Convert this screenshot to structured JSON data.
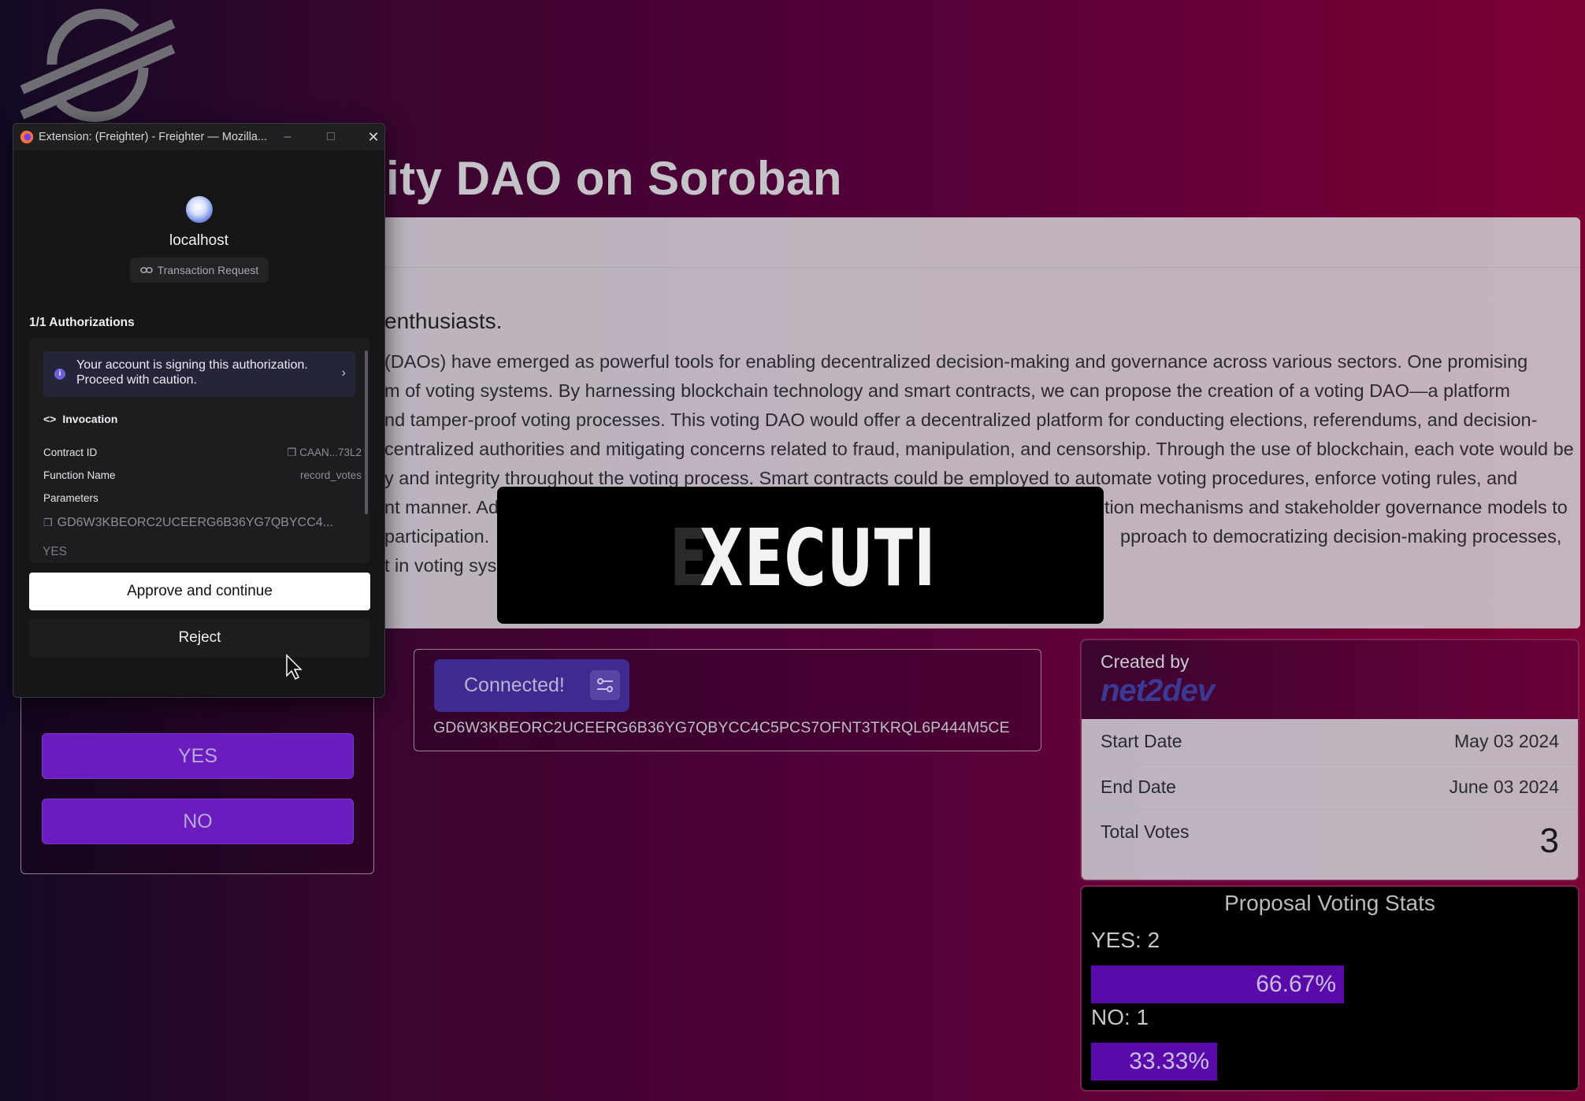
{
  "page": {
    "title": "ity DAO on Soroban"
  },
  "intro": {
    "heading": "enthusiasts.",
    "lines": [
      "(DAOs) have emerged as powerful tools for enabling decentralized decision-making and governance across various sectors. One promising",
      "m of voting systems. By harnessing blockchain technology and smart contracts, we can propose the creation of a voting DAO—a platform",
      "nd tamper-proof voting processes. This voting DAO would offer a decentralized platform for conducting elections, referendums, and decision-",
      " centralized authorities and mitigating concerns related to fraud, manipulation, and censorship. Through the use of blockchain, each vote would be",
      "y and integrity throughout the voting process. Smart contracts could be employed to automate voting procedures, enforce voting rules, and",
      "nt manner. Add",
      "participation.",
      "t in voting syst"
    ],
    "line_tails": {
      "5": "tion mechanisms and stakeholder governance models to",
      "6": "pproach to democratizing decision-making processes,"
    }
  },
  "overlay": {
    "ghost_letter": "E",
    "text": "XECUTI"
  },
  "wallet": {
    "connected_label": "Connected!",
    "address": "GD6W3KBEORC2UCEERG6B36YG7QBYCC4C5PCS7OFNT3TKRQL6P444M5CE"
  },
  "stats": {
    "created_by_label": "Created by",
    "brand": "net2dev",
    "rows": [
      {
        "label": "Start Date",
        "value": "May 03 2024"
      },
      {
        "label": "End Date",
        "value": "June 03 2024"
      },
      {
        "label": "Total Votes",
        "value": "3"
      }
    ]
  },
  "voting_stats": {
    "title": "Proposal Voting Stats",
    "yes_label": "YES: 2",
    "yes_percent": "66.67%",
    "yes_fraction": 0.6667,
    "no_label": "NO: 1",
    "no_percent": "33.33%",
    "no_fraction": 0.3333,
    "bar_color": "#5a0aa8"
  },
  "vote_card": {
    "yes_label": "YES",
    "no_label": "NO"
  },
  "popup": {
    "window_title": "Extension: (Freighter) - Freighter — Mozilla...",
    "site": "localhost",
    "chip": "Transaction Request",
    "auth_title": "1/1 Authorizations",
    "warning": "Your account is signing this authorization. Proceed with caution.",
    "invocation": "Invocation",
    "contract_id_label": "Contract ID",
    "contract_id": "CAAN...73L2",
    "function_label": "Function Name",
    "function_name": "record_votes",
    "params_label": "Parameters",
    "param_value": "GD6W3KBEORC2UCEERG6B36YG7QBYCC4...",
    "yes_value": "YES",
    "approve": "Approve and continue",
    "reject": "Reject"
  }
}
